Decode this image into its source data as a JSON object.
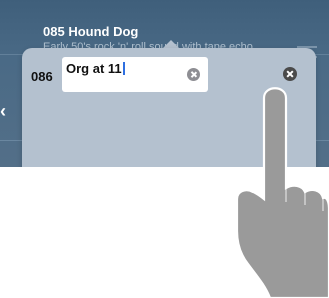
{
  "background_list": {
    "row_number": "085",
    "row_title": "Hound Dog",
    "row_subtitle": "Early 50's rock 'n' roll sound with tape echo"
  },
  "popover": {
    "row_number": "086",
    "name_value": "Org at 11",
    "icons": {
      "clear": "clear-text-icon",
      "close": "close-icon"
    }
  },
  "overlay": {
    "gesture": "tap-finger-icon"
  },
  "colors": {
    "app_background": "#4a6a86",
    "popover_background": "#b4c1cf",
    "caret": "#2f6fe0",
    "hand": "#9a9a9a"
  }
}
